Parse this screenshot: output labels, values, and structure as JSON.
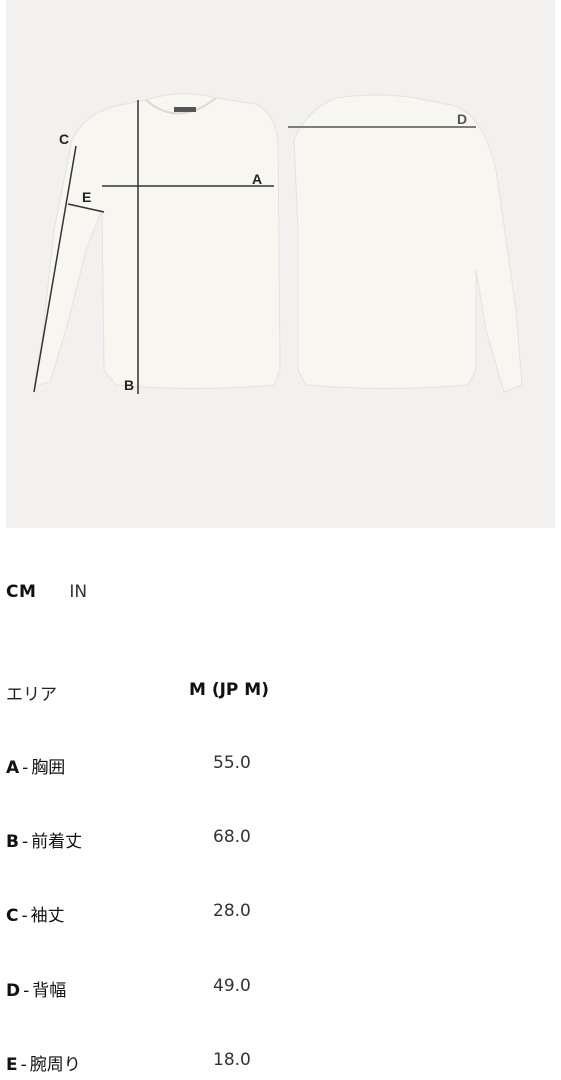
{
  "image": {
    "description_icon": "sweater-measurement-diagram",
    "labels": [
      "A",
      "B",
      "C",
      "D",
      "E"
    ]
  },
  "units": {
    "cm": "CM",
    "in": "IN",
    "selected": "CM"
  },
  "table": {
    "header_area": "エリア",
    "header_size": "M (JP M)",
    "rows": [
      {
        "letter": "A",
        "sep": "-",
        "name": "胸囲",
        "value": "55.0"
      },
      {
        "letter": "B",
        "sep": "-",
        "name": "前着丈",
        "value": "68.0"
      },
      {
        "letter": "C",
        "sep": "-",
        "name": "袖丈",
        "value": "28.0"
      },
      {
        "letter": "D",
        "sep": "-",
        "name": "背幅",
        "value": "49.0"
      },
      {
        "letter": "E",
        "sep": "-",
        "name": "腕周り",
        "value": "18.0"
      }
    ]
  }
}
